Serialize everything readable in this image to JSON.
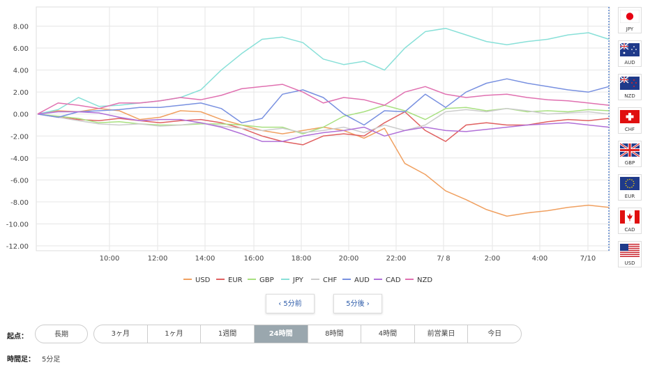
{
  "chart_data": {
    "type": "line",
    "x": [
      "10:00",
      "12:00",
      "14:00",
      "16:00",
      "18:00",
      "20:00",
      "22:00",
      "7/ 8",
      "2:00",
      "4:00",
      "7/10"
    ],
    "ylim": [
      -12,
      10
    ],
    "yticks": [
      "8.00",
      "6.00",
      "4.00",
      "2.00",
      "0.00",
      "-2.00",
      "-4.00",
      "-6.00",
      "-8.00",
      "-10.00",
      "-12.00"
    ],
    "grid": true,
    "legend_position": "bottom",
    "series": [
      {
        "name": "USD",
        "color": "#f0a060",
        "values": [
          0,
          0.3,
          0.2,
          0.5,
          0.3,
          -0.5,
          -0.3,
          0.3,
          0.2,
          -0.5,
          -1.0,
          -1.5,
          -1.8,
          -1.5,
          -1.2,
          -1.5,
          -2.2,
          -1.3,
          -4.5,
          -5.5,
          -7.0,
          -7.8,
          -8.7,
          -9.3,
          -9.0,
          -8.8,
          -8.5,
          -8.3,
          -8.5
        ]
      },
      {
        "name": "EUR",
        "color": "#e06060",
        "values": [
          0,
          -0.3,
          -0.5,
          -0.6,
          -0.4,
          -0.6,
          -0.8,
          -0.6,
          -0.5,
          -0.8,
          -1.3,
          -2.0,
          -2.5,
          -2.8,
          -2.0,
          -1.8,
          -2.0,
          -0.8,
          0.2,
          -1.5,
          -2.5,
          -1.0,
          -0.8,
          -1.0,
          -1.0,
          -0.7,
          -0.5,
          -0.6,
          -0.4
        ]
      },
      {
        "name": "GBP",
        "color": "#a8e080",
        "values": [
          0,
          -0.2,
          -0.4,
          -0.8,
          -0.7,
          -0.9,
          -1.0,
          -1.0,
          -0.9,
          -0.9,
          -1.0,
          -1.2,
          -1.2,
          -1.8,
          -1.2,
          -0.2,
          0.2,
          0.8,
          0.3,
          -0.5,
          0.5,
          0.6,
          0.3,
          0.5,
          0.2,
          0.3,
          0.2,
          0.4,
          0.3
        ]
      },
      {
        "name": "JPY",
        "color": "#88e0d8",
        "values": [
          0,
          0.4,
          1.5,
          0.7,
          0.8,
          1.0,
          1.2,
          1.5,
          2.2,
          4.0,
          5.5,
          6.8,
          7.0,
          6.5,
          5.0,
          4.5,
          4.8,
          4.0,
          6.0,
          7.5,
          7.8,
          7.2,
          6.6,
          6.3,
          6.6,
          6.8,
          7.2,
          7.4,
          6.8
        ]
      },
      {
        "name": "CHF",
        "color": "#cccccc",
        "values": [
          0,
          -0.3,
          -0.6,
          -0.9,
          -1.0,
          -0.9,
          -1.1,
          -1.0,
          -0.8,
          -1.1,
          -1.3,
          -1.5,
          -1.3,
          -1.7,
          -1.5,
          -1.2,
          -1.7,
          -1.0,
          -1.5,
          -1.0,
          0.2,
          0.4,
          0.2,
          0.5,
          0.3,
          0.0,
          0.1,
          0.2,
          0.0
        ]
      },
      {
        "name": "AUD",
        "color": "#7890e0",
        "values": [
          0,
          -0.3,
          0.2,
          0.3,
          0.4,
          0.6,
          0.6,
          0.8,
          1.0,
          0.5,
          -0.8,
          -0.4,
          1.8,
          2.2,
          1.5,
          0.0,
          -1.0,
          0.3,
          0.2,
          1.8,
          0.6,
          2.0,
          2.8,
          3.2,
          2.8,
          2.5,
          2.2,
          2.0,
          2.5
        ]
      },
      {
        "name": "CAD",
        "color": "#b070d8",
        "values": [
          0,
          0.2,
          0.2,
          0.1,
          -0.3,
          -0.6,
          -0.5,
          -0.5,
          -0.8,
          -1.2,
          -1.8,
          -2.5,
          -2.5,
          -2.0,
          -1.7,
          -1.5,
          -1.2,
          -2.0,
          -1.5,
          -1.2,
          -1.5,
          -1.6,
          -1.4,
          -1.2,
          -1.0,
          -0.9,
          -0.8,
          -1.0,
          -1.2
        ]
      },
      {
        "name": "NZD",
        "color": "#e070b0",
        "values": [
          0,
          1.0,
          0.8,
          0.5,
          1.0,
          1.0,
          1.2,
          1.5,
          1.3,
          1.7,
          2.3,
          2.5,
          2.7,
          2.0,
          1.0,
          1.5,
          1.3,
          0.8,
          2.0,
          2.5,
          1.8,
          1.5,
          1.7,
          1.8,
          1.5,
          1.3,
          1.2,
          1.0,
          0.8
        ]
      }
    ]
  },
  "flags": [
    {
      "code": "JPY",
      "icon": "japan-flag"
    },
    {
      "code": "AUD",
      "icon": "australia-flag"
    },
    {
      "code": "NZD",
      "icon": "new-zealand-flag"
    },
    {
      "code": "CHF",
      "icon": "switzerland-flag"
    },
    {
      "code": "GBP",
      "icon": "uk-flag"
    },
    {
      "code": "EUR",
      "icon": "eu-flag"
    },
    {
      "code": "CAD",
      "icon": "canada-flag"
    },
    {
      "code": "USD",
      "icon": "usa-flag"
    }
  ],
  "nav": {
    "prev": "‹ 5分前",
    "next": "5分後 ›"
  },
  "controls": {
    "start_label": "起点：",
    "long_label": "長期",
    "periods": [
      "3ヶ月",
      "1ヶ月",
      "1週間",
      "24時間",
      "8時間",
      "4時間",
      "前営業日",
      "今日"
    ],
    "active_period": "24時間",
    "interval_label": "時間足：",
    "interval_value": "5分足"
  },
  "colors": {
    "grid": "#e6e6e6",
    "marker": "#3a6fc8",
    "accent": "#2b5aa8"
  }
}
